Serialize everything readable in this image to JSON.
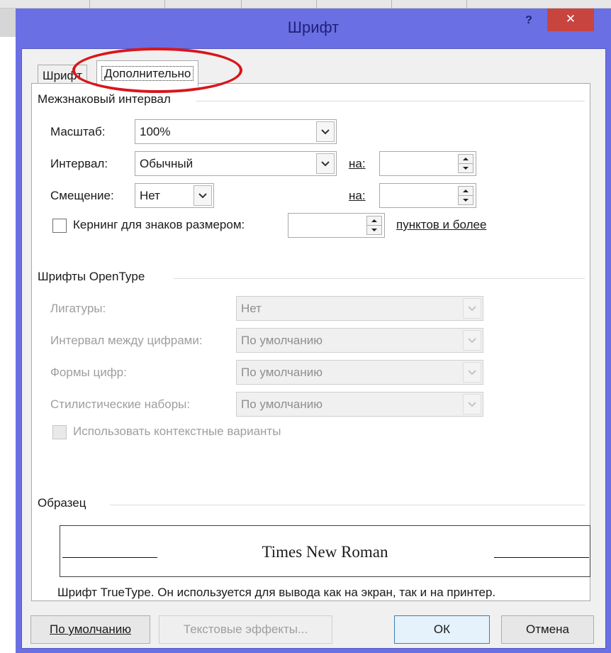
{
  "dialog": {
    "title": "Шрифт",
    "help_label": "?",
    "close_label": "✕"
  },
  "tabs": [
    {
      "label": "Шрифт",
      "selected": false
    },
    {
      "label": "Дополнительно",
      "selected": true
    }
  ],
  "spacing": {
    "group_title": "Межзнаковый интервал",
    "scale_label": "Масштаб:",
    "scale_value": "100%",
    "spacing_label": "Интервал:",
    "spacing_value": "Обычный",
    "spacing_by_label": "на:",
    "spacing_by_value": "",
    "position_label": "Смещение:",
    "position_value": "Нет",
    "position_by_label": "на:",
    "position_by_value": "",
    "kerning_label": "Кернинг для знаков размером:",
    "kerning_checked": false,
    "kerning_value": "",
    "kerning_suffix": "пунктов и более"
  },
  "opentype": {
    "group_title": "Шрифты OpenType",
    "ligatures_label": "Лигатуры:",
    "ligatures_value": "Нет",
    "number_spacing_label": "Интервал между цифрами:",
    "number_spacing_value": "По умолчанию",
    "number_forms_label": "Формы цифр:",
    "number_forms_value": "По умолчанию",
    "stylistic_sets_label": "Стилистические наборы:",
    "stylistic_sets_value": "По умолчанию",
    "contextual_label": "Использовать контекстные варианты",
    "contextual_checked": false
  },
  "preview": {
    "group_title": "Образец",
    "font_name": "Times New Roman",
    "description": "Шрифт TrueType. Он используется для вывода как на экран, так и на принтер."
  },
  "buttons": {
    "default": "По умолчанию",
    "text_effects": "Текстовые эффекты...",
    "ok": "ОК",
    "cancel": "Отмена"
  },
  "colors": {
    "title_bar": "#6b6fe4",
    "close_button": "#c7443f",
    "annotation": "#d8161b"
  }
}
